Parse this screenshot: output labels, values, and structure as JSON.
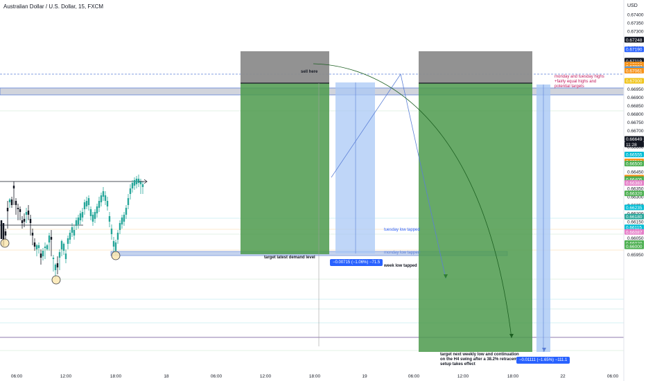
{
  "header": {
    "title": "Australian Dollar / U.S. Dollar, 15, FXCM",
    "currency": "USD"
  },
  "price_axis": {
    "levels": [
      "0.67400",
      "0.67350",
      "0.67300",
      "0.67200",
      "0.66950",
      "0.66900",
      "0.66850",
      "0.66800",
      "0.66750",
      "0.66700",
      "0.66600",
      "0.66550",
      "0.66500",
      "0.66450",
      "0.66350",
      "0.66300",
      "0.66250",
      "0.66200",
      "0.66150",
      "0.66100",
      "0.66050",
      "0.66000",
      "0.65950"
    ],
    "badges": [
      {
        "text": "0.67249",
        "bg": "#131722",
        "fg": "#ffffff"
      },
      {
        "text": "0.67248",
        "bg": "#131722",
        "fg": "#ffffff"
      },
      {
        "text": "0.67190",
        "bg": "#2962ff",
        "fg": "#ffffff"
      },
      {
        "text": "0.67122",
        "bg": "#131722",
        "fg": "#ffffff"
      },
      {
        "text": "0.67119",
        "bg": "#131722",
        "fg": "#ffffff"
      },
      {
        "text": "0.67098",
        "bg": "#f7931a",
        "fg": "#ffffff"
      },
      {
        "text": "0.67087",
        "bg": "#f7931a",
        "fg": "#ffffff"
      },
      {
        "text": "0.67070",
        "bg": "#5b9bd5",
        "fg": "#ffffff"
      },
      {
        "text": "0.67061",
        "bg": "#f7931a",
        "fg": "#ffffff"
      },
      {
        "text": "0.67000",
        "bg": "#f0c419",
        "fg": "#ffffff"
      },
      {
        "text": "0.66649",
        "bg": "#131722",
        "fg": "#ffffff"
      },
      {
        "text": "11:28",
        "bg": "#131722",
        "fg": "#ffffff"
      },
      {
        "text": "0.66555",
        "bg": "#00bcd4",
        "fg": "#ffffff"
      },
      {
        "text": "0.66513",
        "bg": "#f7931a",
        "fg": "#ffffff"
      },
      {
        "text": "0.66500",
        "bg": "#4caf50",
        "fg": "#ffffff"
      },
      {
        "text": "0.66415",
        "bg": "#f7931a",
        "fg": "#ffffff"
      },
      {
        "text": "0.66406",
        "bg": "#1b5e20",
        "fg": "#ffffff"
      },
      {
        "text": "0.66405",
        "bg": "#4caf50",
        "fg": "#ffffff"
      },
      {
        "text": "0.66383",
        "bg": "#e57fc8",
        "fg": "#ffffff"
      },
      {
        "text": "0.66320",
        "bg": "#4caf50",
        "fg": "#ffffff"
      },
      {
        "text": "0.66235",
        "bg": "#00bcd4",
        "fg": "#ffffff"
      },
      {
        "text": "0.66180",
        "bg": "#26a69a",
        "fg": "#ffffff"
      },
      {
        "text": "0.66115",
        "bg": "#00bcd4",
        "fg": "#ffffff"
      },
      {
        "text": "0.66087",
        "bg": "#e57fc8",
        "fg": "#ffffff"
      },
      {
        "text": "0.66020",
        "bg": "#4caf50",
        "fg": "#ffffff"
      },
      {
        "text": "0.66000",
        "bg": "#4caf50",
        "fg": "#ffffff"
      }
    ]
  },
  "time_axis": {
    "labels": [
      "06:00",
      "12:00",
      "18:00",
      "18",
      "06:00",
      "12:00",
      "18:00",
      "19",
      "06:00",
      "12:00",
      "18:00",
      "22",
      "06:00"
    ]
  },
  "annotations": {
    "sell_here": "sell here",
    "monday_tuesday": "monday and tuesday highs\n+fairly equal highs and\npotential targets",
    "tuesday_low": "tuesday low tapped",
    "monday_low": "monday low tapped",
    "target_demand": "target latest demand level",
    "week_low": "week low tapped",
    "target_next": "target next weekly low and continuation\non the H4 swing after a 38.2% retracement\nsetup takes effect",
    "pl_left": "−0.00715 (−1.06%) −71.5",
    "pl_right": "−0.01111 (−1.65%) −111.1"
  },
  "colors": {
    "up": "#26a69a",
    "down": "#131722",
    "profit": "#4c9a4c",
    "loss": "#808080",
    "blue_zone": "#b3d1fa",
    "accent": "#2962ff"
  }
}
